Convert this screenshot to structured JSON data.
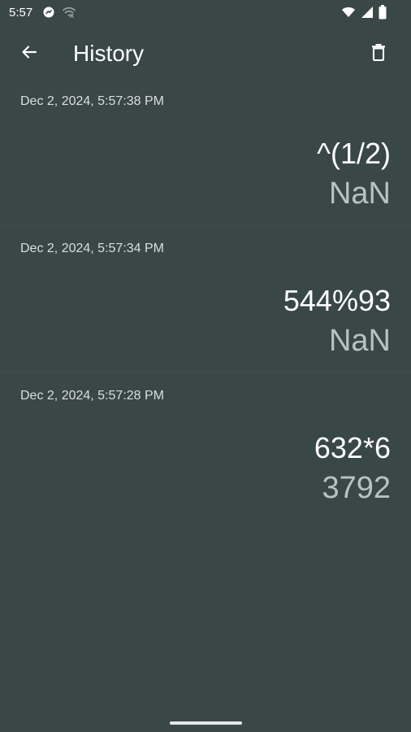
{
  "status_bar": {
    "time": "5:57",
    "icons_left": [
      "notification-icon",
      "wifi-off-icon"
    ],
    "icons_right": [
      "wifi-icon",
      "cell-signal-icon",
      "battery-icon"
    ]
  },
  "app_bar": {
    "title": "History",
    "back_icon": "arrow-left-icon",
    "delete_icon": "trash-icon"
  },
  "history": [
    {
      "date": "Dec 2, 2024, 5:57:38 PM",
      "expression": "^(1/2)",
      "result": "NaN"
    },
    {
      "date": "Dec 2, 2024, 5:57:34 PM",
      "expression": "544%93",
      "result": "NaN"
    },
    {
      "date": "Dec 2, 2024, 5:57:28 PM",
      "expression": "632*6",
      "result": "3792"
    }
  ],
  "colors": {
    "background": "#394746",
    "text_primary": "#ffffff",
    "text_secondary": "#b9c2c1"
  }
}
